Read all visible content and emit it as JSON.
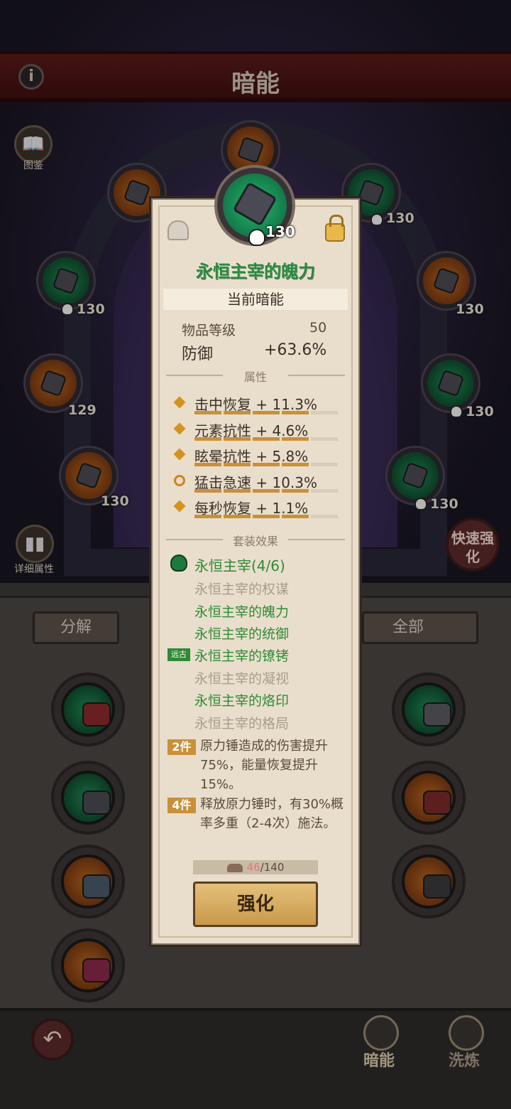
{
  "header": {
    "title": "暗能",
    "info_icon": "i"
  },
  "left_buttons": {
    "codex": "图鉴",
    "details": "详细属性"
  },
  "quick_enhance": "快速强化",
  "gems": [
    {
      "lvl": "130",
      "color": "green"
    },
    {
      "lvl": "130",
      "color": "orange"
    },
    {
      "lvl": "129",
      "color": "orange"
    },
    {
      "lvl": "130",
      "color": "green"
    },
    {
      "lvl": "130",
      "color": "orange"
    },
    {
      "lvl": "130",
      "color": "green"
    },
    {
      "lvl": "130",
      "color": "green"
    }
  ],
  "inventory": {
    "decompose": "分解",
    "filter": "全部"
  },
  "card": {
    "level": "130",
    "name": "永恒主宰的魄力",
    "current_label": "当前暗能",
    "item_level_label": "物品等级",
    "item_level_value": "50",
    "stat_label": "防御",
    "stat_value": "+63.6%",
    "attributes_title": "属性",
    "attributes": [
      {
        "text": "击中恢复 + 11.3%",
        "fill": 0.8
      },
      {
        "text": "元素抗性 + 4.6%",
        "fill": 0.8
      },
      {
        "text": "眩晕抗性 + 5.8%",
        "fill": 0.8
      },
      {
        "text": "猛击急速 + 10.3%",
        "fill": 0.8
      },
      {
        "text": "每秒恢复 + 1.1%",
        "fill": 0.8
      }
    ],
    "set_title": "套装效果",
    "set_name": "永恒主宰(4/6)",
    "set_items": [
      {
        "name": "永恒主宰的权谋",
        "owned": false
      },
      {
        "name": "永恒主宰的魄力",
        "owned": true
      },
      {
        "name": "永恒主宰的统御",
        "owned": true
      },
      {
        "name": "永恒主宰的镣铐",
        "owned": true
      },
      {
        "name": "永恒主宰的凝视",
        "owned": false
      },
      {
        "name": "永恒主宰的烙印",
        "owned": true
      },
      {
        "name": "永恒主宰的格局",
        "owned": false
      }
    ],
    "ancient_tag": "远古",
    "bonus2_label": "2件",
    "bonus2_text": "原力锤造成的伤害提升75%，能量恢复提升15%。",
    "bonus4_label": "4件",
    "bonus4_text": "释放原力锤时，有30%概率多重（2-4次）施法。",
    "cost_current": "46",
    "cost_total": "/140",
    "upgrade_button": "强化"
  },
  "nav": {
    "back": "↶",
    "dark_energy": "暗能",
    "refine": "洗炼"
  },
  "colors": {
    "green_text": "#2f8a36",
    "accent": "#c9903a",
    "card_bg": "#e9decb"
  }
}
